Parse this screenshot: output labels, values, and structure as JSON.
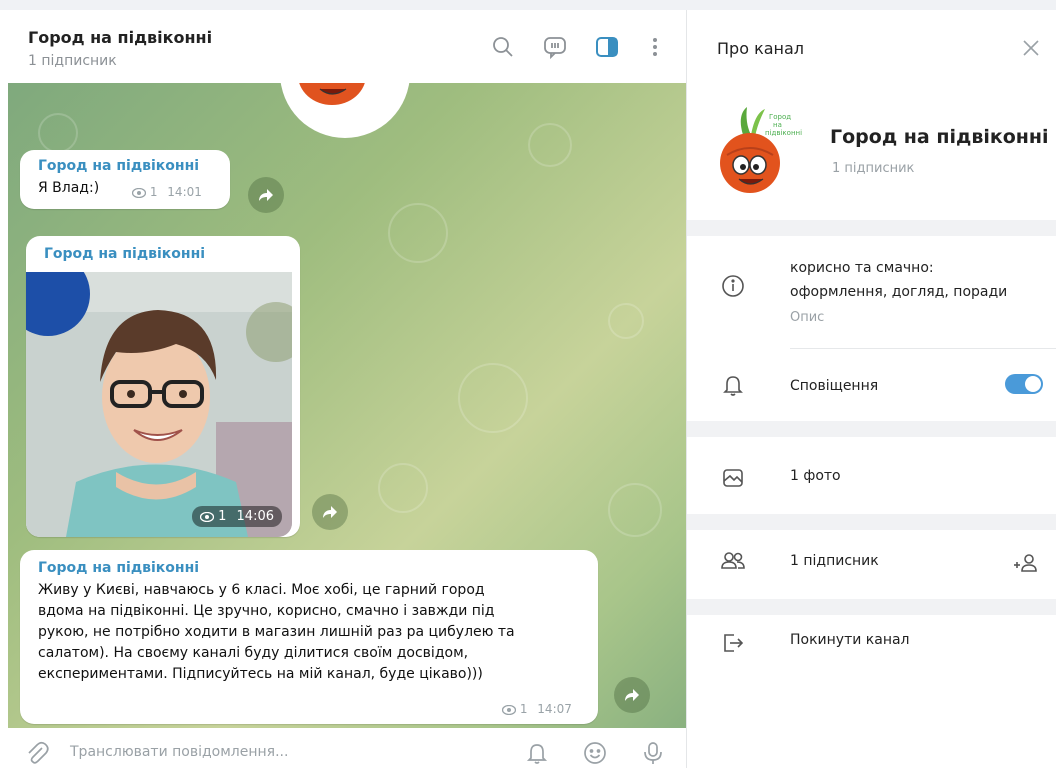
{
  "chat_header": {
    "title": "Город на підвіконні",
    "subtitle": "1 підписник",
    "icons": [
      "search-icon",
      "discussion-icon",
      "sidebar-toggle-icon",
      "more-icon"
    ]
  },
  "messages": [
    {
      "author": "Город на підвіконні",
      "text": "Я Влад:)",
      "views": "1",
      "time": "14:01"
    },
    {
      "author": "Город на підвіконні",
      "type": "photo",
      "views": "1",
      "time": "14:06"
    },
    {
      "author": "Город на підвіконні",
      "lines": [
        "Живу у Києві, навчаюсь у 6 класі. Моє хобі, це гарний город",
        "вдома на підвіконні. Це зручно, корисно, смачно і завжди під",
        "рукою, не потрібно ходити в магазин лишній раз ра цибулею та",
        "салатом). На своєму каналі буду ділитися своїм досвідом,",
        "експериментами. Підписуйтесь на мій канал, буде цікаво)))"
      ],
      "views": "1",
      "time": "14:07"
    }
  ],
  "composer": {
    "placeholder": "Транслювати повідомлення..."
  },
  "panel": {
    "title": "Про канал",
    "channel_name": "Город на підвіконні",
    "subscribers": "1 підписник",
    "avatar_caption": [
      "Город",
      "на",
      "підвіконні"
    ],
    "description_line1": "корисно та смачно:",
    "description_line2": "оформлення, догляд, поради",
    "description_label": "Опис",
    "notifications_label": "Сповіщення",
    "notifications_on": true,
    "photos_label": "1 фото",
    "members_label": "1 підписник",
    "leave_label": "Покинути канал"
  },
  "colors": {
    "accent": "#3a8fc0",
    "toggle": "#4a9ad9",
    "wallpaper_start": "#7fa97d",
    "wallpaper_end": "#c7d39a"
  }
}
